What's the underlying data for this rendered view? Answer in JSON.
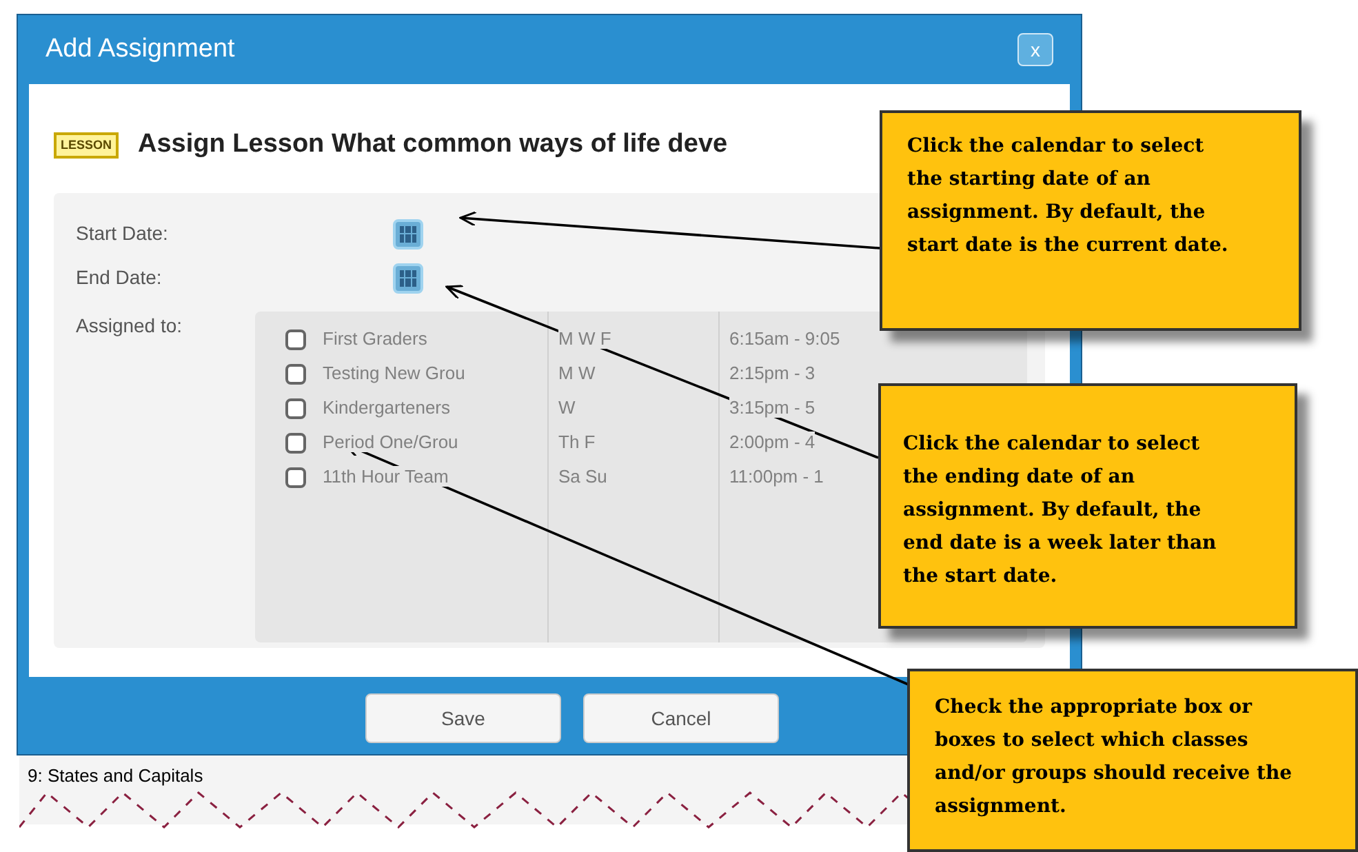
{
  "window": {
    "title": "Add Assignment",
    "close": "x"
  },
  "lesson_badge": "LESSON",
  "heading": "Assign Lesson What common ways of life deve",
  "fields": [
    {
      "label": "Start Date:"
    },
    {
      "label": "End Date:"
    }
  ],
  "assigned_label": "Assigned to:",
  "groups": [
    {
      "name": "First Graders",
      "days": "M W F",
      "time": "6:15am - 9:05",
      "checked": false
    },
    {
      "name": "Testing New Grou",
      "days": "M W",
      "time": "2:15pm - 3",
      "checked": false
    },
    {
      "name": "Kindergarteners",
      "days": "W",
      "time": "3:15pm - 5",
      "checked": false
    },
    {
      "name": "Period One/Grou",
      "days": "Th F",
      "time": "2:00pm - 4",
      "checked": false
    },
    {
      "name": "11th Hour Team",
      "days": "Sa Su",
      "time": "11:00pm - 1",
      "checked": false
    }
  ],
  "buttons": [
    "Save",
    "Cancel"
  ],
  "background_text": "9: States and Capitals",
  "callouts": [
    {
      "text": "Click the calendar to select the starting date of an assignment. By default, the start date is the current date."
    },
    {
      "text": "Click the calendar to select the ending date of an assignment. By default, the end date is a week later than the start date."
    },
    {
      "text": "Check the appropriate box or boxes to select which classes and/or groups should receive the assignment."
    }
  ]
}
